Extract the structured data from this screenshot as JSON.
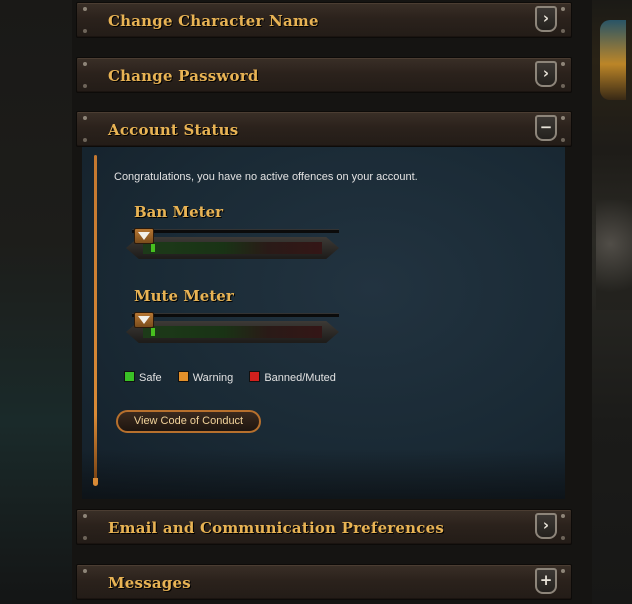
{
  "sections": [
    {
      "title": "Change Character Name",
      "state": "collapsed",
      "button_glyph": "›"
    },
    {
      "title": "Change Password",
      "state": "collapsed",
      "button_glyph": "›"
    },
    {
      "title": "Account Status",
      "state": "expanded",
      "button_glyph": "−"
    },
    {
      "title": "Email and Communication Preferences",
      "state": "collapsed",
      "button_glyph": "›"
    },
    {
      "title": "Messages",
      "state": "collapsed",
      "button_glyph": "+"
    }
  ],
  "account_status": {
    "message": "Congratulations, you have no active offences on your account.",
    "ban_meter": {
      "title": "Ban Meter",
      "level": 0
    },
    "mute_meter": {
      "title": "Mute Meter",
      "level": 0
    },
    "legend": [
      {
        "label": "Safe",
        "color": "#3ac126"
      },
      {
        "label": "Warning",
        "color": "#e3902a"
      },
      {
        "label": "Banned/Muted",
        "color": "#d1201d"
      }
    ],
    "conduct_button": "View Code of Conduct"
  },
  "colors": {
    "accent": "#e8b354",
    "panel_bg": "#1a2a35",
    "border_orange": "#b7702d"
  }
}
